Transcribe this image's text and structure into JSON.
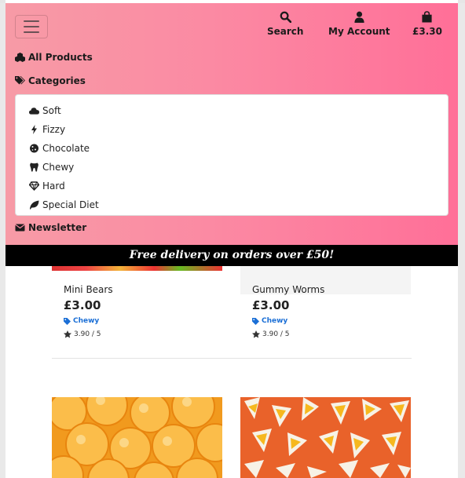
{
  "header": {
    "nav": {
      "search_label": "Search",
      "account_label": "My Account",
      "basket_label": "£3.30"
    },
    "menu": {
      "all_products": "All Products",
      "categories": "Categories",
      "newsletter": "Newsletter"
    },
    "categories": [
      {
        "label": "Soft",
        "icon": "cloud-icon"
      },
      {
        "label": "Fizzy",
        "icon": "bolt-icon"
      },
      {
        "label": "Chocolate",
        "icon": "cookie-icon"
      },
      {
        "label": "Chewy",
        "icon": "tooth-icon"
      },
      {
        "label": "Hard",
        "icon": "gem-icon"
      },
      {
        "label": "Special Diet",
        "icon": "leaf-icon"
      }
    ],
    "colors": {
      "gradient_start": "#f79ba6",
      "gradient_end": "#ff6f98"
    }
  },
  "banner": {
    "text": "Free delivery on orders over £50!"
  },
  "products": [
    {
      "name": "Mini Bears",
      "price": "£3.00",
      "category": "Chewy",
      "rating": "3.90 / 5"
    },
    {
      "name": "Gummy Worms",
      "price": "£3.00",
      "category": "Chewy",
      "rating": "3.90 / 5"
    }
  ],
  "colors": {
    "tag": "#1b6fd6",
    "banner_bg": "#000000"
  }
}
